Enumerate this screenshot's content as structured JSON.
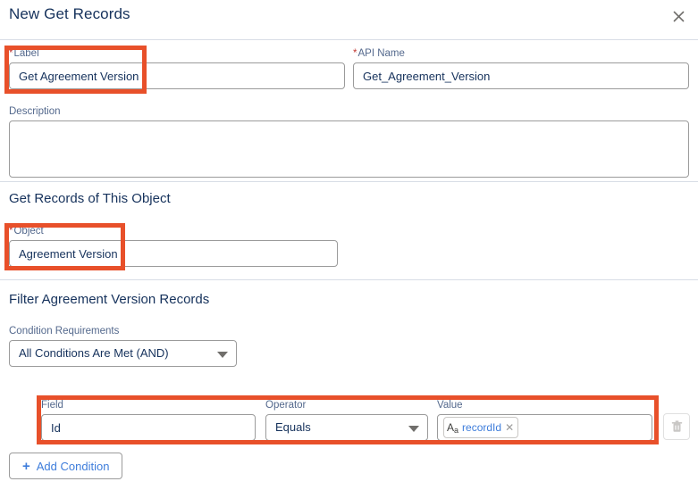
{
  "header": {
    "title": "New Get Records",
    "close_icon": "close-icon"
  },
  "label_field": {
    "label": "Label",
    "required_marker": "*",
    "value": "Get Agreement Version"
  },
  "api_name_field": {
    "label": "API Name",
    "required_marker": "*",
    "value": "Get_Agreement_Version"
  },
  "description_field": {
    "label": "Description",
    "value": "",
    "placeholder": ""
  },
  "object_section": {
    "title": "Get Records of This Object",
    "object_field": {
      "label": "Object",
      "required_marker": "*",
      "value": "Agreement Version"
    }
  },
  "filter_section": {
    "title": "Filter Agreement Version Records",
    "condition_requirements": {
      "label": "Condition Requirements",
      "value": "All Conditions Are Met (AND)"
    },
    "columns": {
      "field": "Field",
      "operator": "Operator",
      "value": "Value"
    },
    "rows": [
      {
        "field": "Id",
        "operator": "Equals",
        "value_pill": {
          "datatype_icon": "text-datatype-icon",
          "datatype_glyph_big": "A",
          "datatype_glyph_small": "a",
          "text": "recordId",
          "remove_icon": "remove-pill-icon"
        },
        "delete_icon": "trash-icon"
      }
    ],
    "add_condition": {
      "icon": "plus-icon",
      "label": "Add Condition"
    }
  },
  "colors": {
    "annotation": "#e8502a",
    "link": "#3e7ddb",
    "title": "#16325c",
    "label": "#54698d",
    "required": "#c23934",
    "border": "#9b9b9b",
    "divider": "#d8dde6"
  }
}
